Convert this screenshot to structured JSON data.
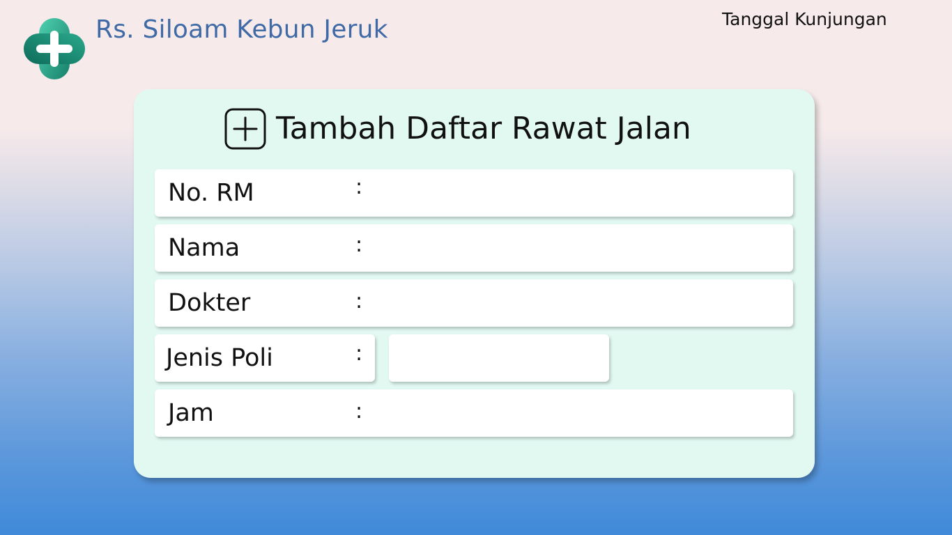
{
  "app": {
    "brand": "Rs. Siloam Kebun Jeruk",
    "logo_icon": "medical-cross-icon",
    "visit_date_label": "Tanggal Kunjungan"
  },
  "form": {
    "icon": "plus-square-icon",
    "title": "Tambah Daftar Rawat Jalan",
    "separator": ":",
    "fields": {
      "no_rm": {
        "label": "No. RM",
        "value": ""
      },
      "nama": {
        "label": "Nama",
        "value": ""
      },
      "dokter": {
        "label": "Dokter",
        "value": ""
      },
      "jenis_poli": {
        "label": "Jenis Poli",
        "value": ""
      },
      "jam": {
        "label": "Jam",
        "value": ""
      }
    }
  },
  "colors": {
    "brand_text": "#3f6aa6",
    "card_bg": "#e2f9f2",
    "logo_dark": "#1b8a72",
    "logo_light": "#3cc6a6"
  }
}
